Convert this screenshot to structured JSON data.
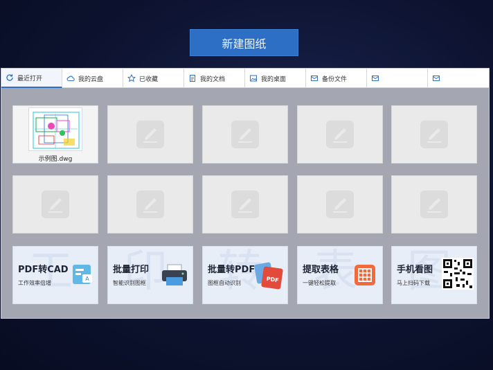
{
  "new_button": "新建图纸",
  "tabs": [
    {
      "label": "最近打开",
      "icon": "refresh-icon"
    },
    {
      "label": "我的云盘",
      "icon": "cloud-icon"
    },
    {
      "label": "已收藏",
      "icon": "star-icon"
    },
    {
      "label": "我的文档",
      "icon": "document-icon"
    },
    {
      "label": "我的桌面",
      "icon": "image-icon"
    },
    {
      "label": "备份文件",
      "icon": "mail-icon"
    },
    {
      "label": "",
      "icon": "mail-icon"
    },
    {
      "label": "",
      "icon": "mail-icon"
    }
  ],
  "files": [
    {
      "name": "示例图.dwg"
    }
  ],
  "features": [
    {
      "title": "PDF转CAD",
      "subtitle": "工作效率倍增",
      "icon": "pdf-to-cad-icon",
      "bg": "工"
    },
    {
      "title": "批量打印",
      "subtitle": "智能识别图框",
      "icon": "printer-icon",
      "bg": "印"
    },
    {
      "title": "批量转PDF",
      "subtitle": "图框自动识别",
      "icon": "pdf-icon",
      "bg": "转"
    },
    {
      "title": "提取表格",
      "subtitle": "一键轻松提取",
      "icon": "table-icon",
      "bg": "表"
    },
    {
      "title": "手机看图",
      "subtitle": "马上扫码下载",
      "icon": "qr-code-icon",
      "bg": "图"
    }
  ],
  "colors": {
    "accent": "#2d6fc4",
    "panel": "#a4a7b2",
    "pdf_red": "#e24b3b",
    "table_orange": "#f06a3d"
  }
}
